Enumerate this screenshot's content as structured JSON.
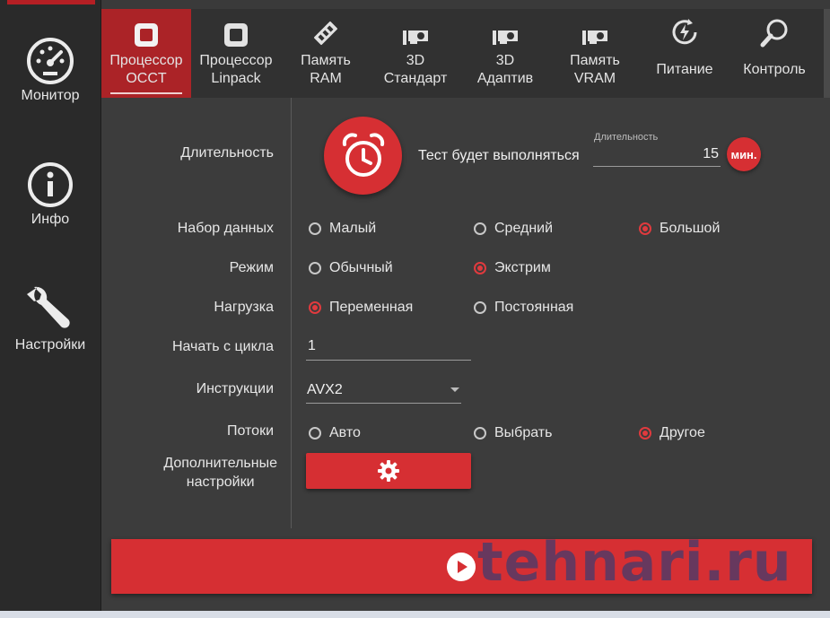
{
  "sidebar": {
    "items": [
      {
        "label": "Монитор",
        "icon": "gauge-icon"
      },
      {
        "label": "Инфо",
        "icon": "info-icon"
      },
      {
        "label": "Настройки",
        "icon": "wrench-icon"
      }
    ]
  },
  "tabs": [
    {
      "label": "Процессор\nOCCT",
      "icon": "cpu-icon",
      "active": true
    },
    {
      "label": "Процессор\nLinpack",
      "icon": "cpu-icon",
      "active": false
    },
    {
      "label": "Память\nRAM",
      "icon": "ram-icon",
      "active": false
    },
    {
      "label": "3D\nСтандарт",
      "icon": "gpu-icon",
      "active": false
    },
    {
      "label": "3D\nАдаптив",
      "icon": "gpu-icon",
      "active": false
    },
    {
      "label": "Память\nVRAM",
      "icon": "gpu-icon",
      "active": false
    },
    {
      "label": "Питание",
      "icon": "power-icon",
      "active": false
    },
    {
      "label": "Контроль",
      "icon": "search-icon",
      "active": false
    }
  ],
  "settings": {
    "duration": {
      "label": "Длительность",
      "run_text": "Тест будет выполняться",
      "field_caption": "Длительность",
      "value": "15",
      "unit": "мин."
    },
    "dataset": {
      "label": "Набор данных",
      "options": [
        "Малый",
        "Средний",
        "Большой"
      ],
      "selected": "Большой"
    },
    "mode": {
      "label": "Режим",
      "options": [
        "Обычный",
        "Экстрим"
      ],
      "selected": "Экстрим"
    },
    "load": {
      "label": "Нагрузка",
      "options": [
        "Переменная",
        "Постоянная"
      ],
      "selected": "Переменная"
    },
    "start_cycle": {
      "label": "Начать с цикла",
      "value": "1"
    },
    "instructions": {
      "label": "Инструкции",
      "value": "AVX2"
    },
    "threads": {
      "label": "Потоки",
      "options": [
        "Авто",
        "Выбрать",
        "Другое"
      ],
      "selected": "Другое"
    },
    "advanced": {
      "label": "Дополнительные\nнастройки"
    }
  },
  "watermark": "tehnari.ru",
  "colors": {
    "accent": "#d62f33",
    "tab_active": "#ab2327",
    "background": "#3c3c3c",
    "sidebar": "#2a2a2a"
  }
}
